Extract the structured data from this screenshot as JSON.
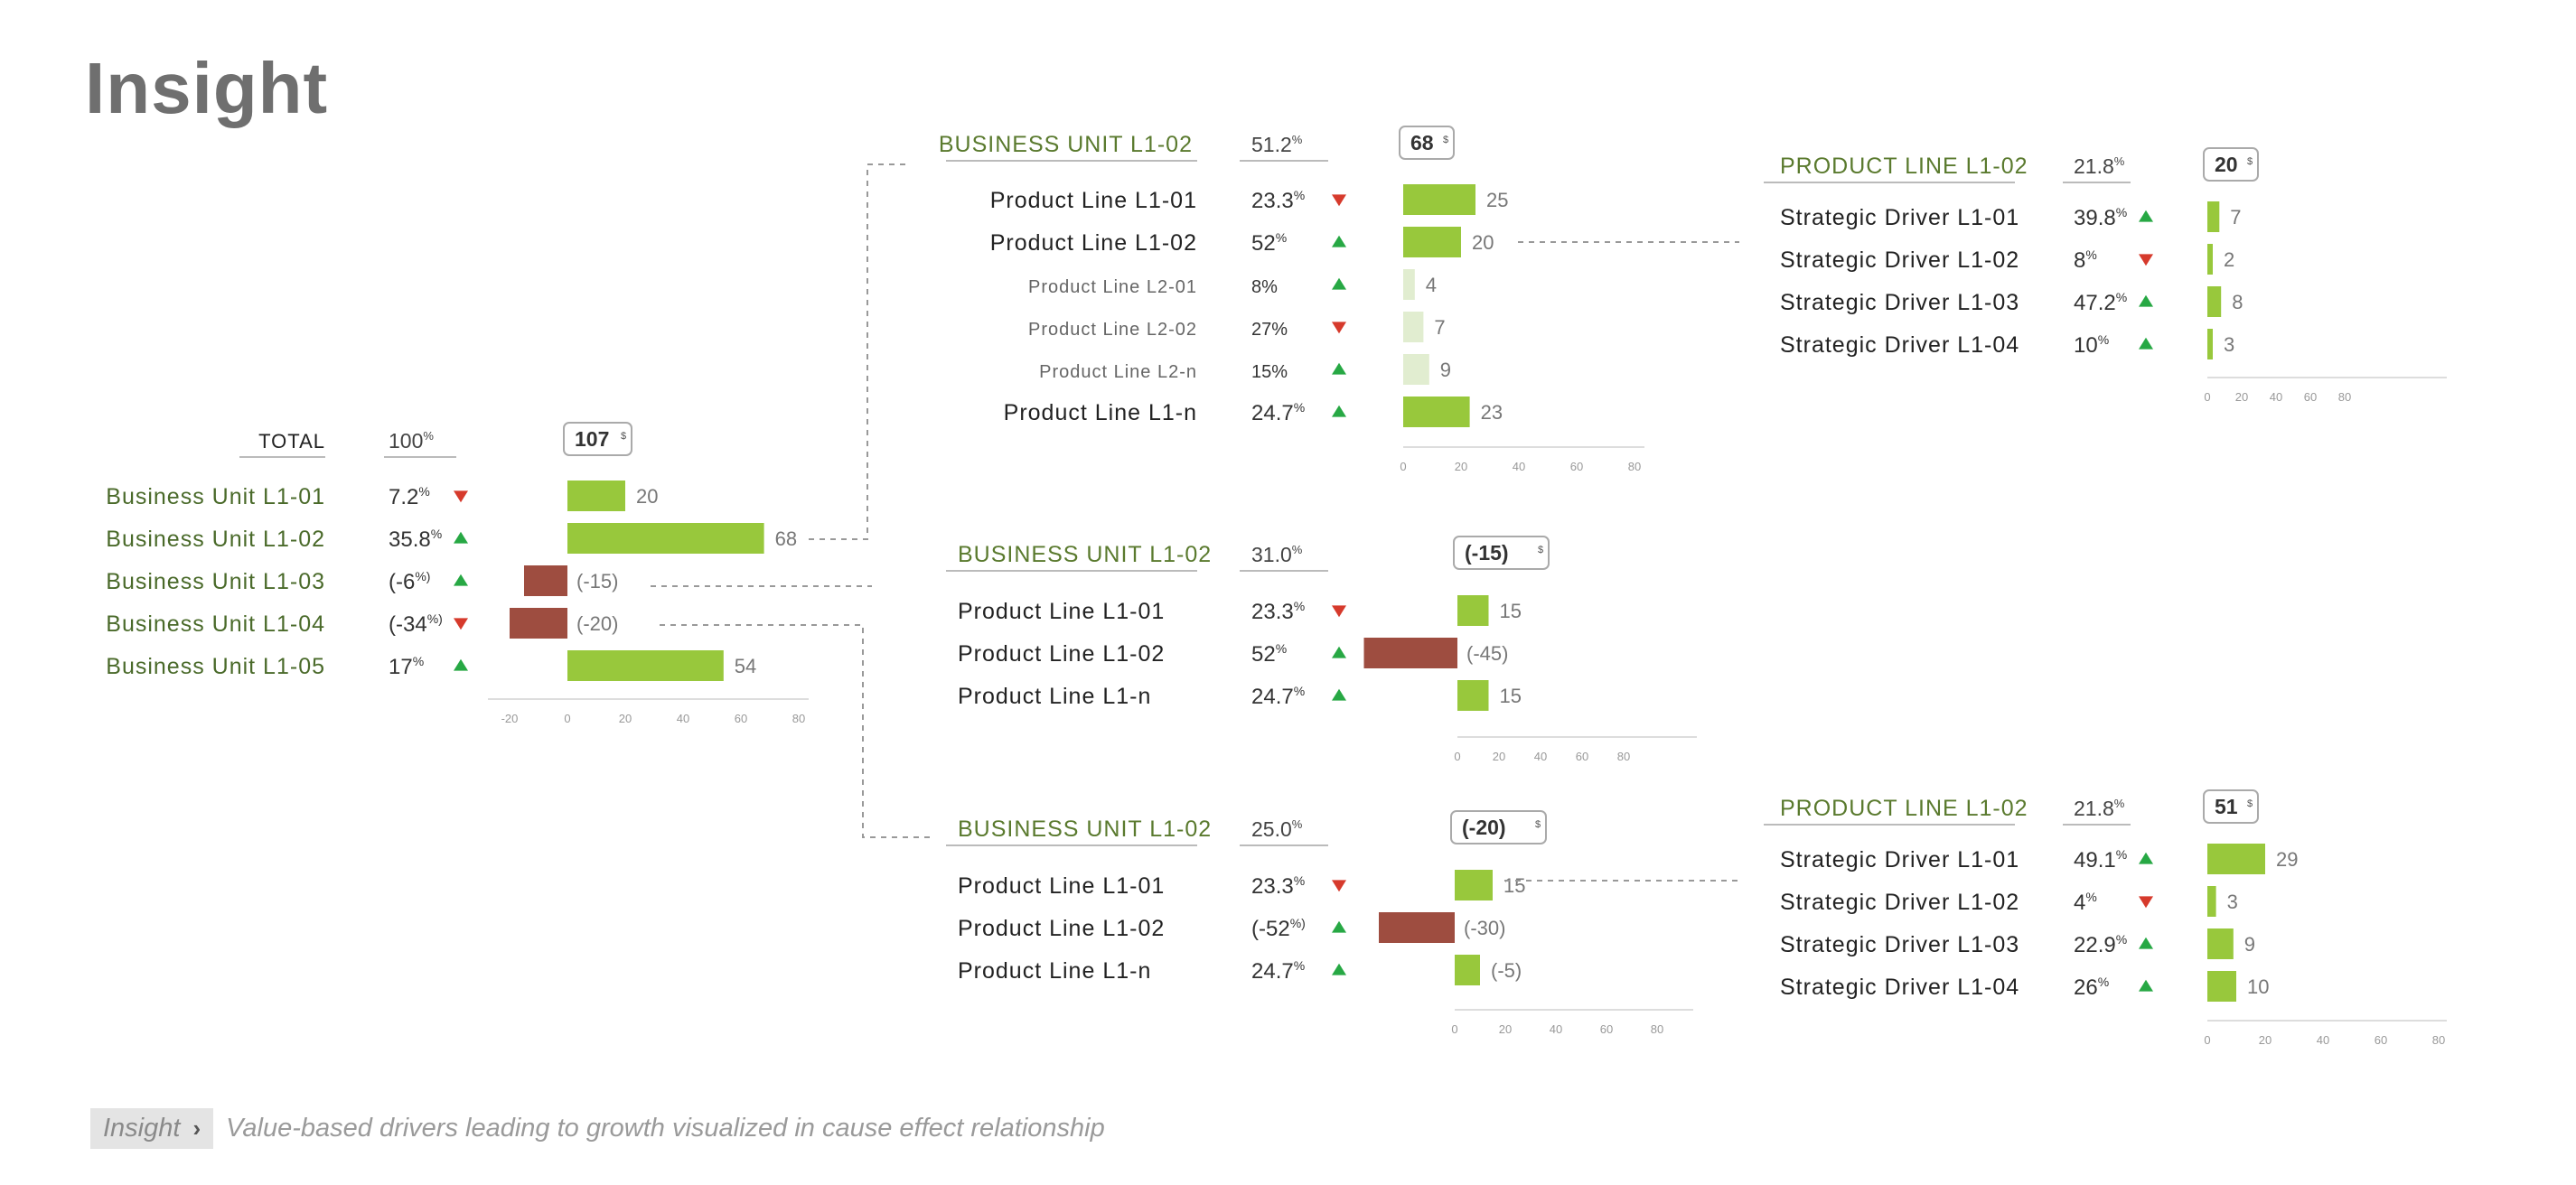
{
  "page": {
    "title": "Insight",
    "footer": {
      "tag": "Insight",
      "text": "Value-based drivers leading to growth visualized in cause effect relationship"
    }
  },
  "colors": {
    "positive": "#98c83c",
    "negative": "#9e4d40",
    "light": "#e1edd0",
    "header": "#5a7a2e",
    "up": "#27a844",
    "down": "#d63a2c",
    "axis": "#dddddd"
  },
  "chart_data": [
    {
      "type": "bar",
      "orientation": "horizontal",
      "id": "total",
      "header": {
        "label": "TOTAL",
        "pct": "100",
        "pct_unit": "%",
        "total": "107"
      },
      "xticks": [
        -20,
        0,
        20,
        40,
        60,
        80
      ],
      "xlim": [
        -25,
        80
      ],
      "rows": [
        {
          "label": "Business Unit L1-01",
          "pct": "7.2",
          "pct_unit": "%",
          "trend": "down",
          "value": 20,
          "value_label": "20"
        },
        {
          "label": "Business Unit L1-02",
          "pct": "35.8",
          "pct_unit": "%",
          "trend": "up",
          "value": 68,
          "value_label": "68"
        },
        {
          "label": "Business Unit L1-03",
          "pct": "(-6",
          "pct_unit": "%)",
          "trend": "up",
          "value": -15,
          "value_label": "(-15)"
        },
        {
          "label": "Business Unit L1-04",
          "pct": "(-34",
          "pct_unit": "%)",
          "trend": "down",
          "value": -20,
          "value_label": "(-20)"
        },
        {
          "label": "Business Unit L1-05",
          "pct": "17",
          "pct_unit": "%",
          "trend": "up",
          "value": 54,
          "value_label": "54"
        }
      ]
    },
    {
      "type": "bar",
      "orientation": "horizontal",
      "id": "bu-a",
      "header": {
        "label": "BUSINESS UNIT L1-02",
        "pct": "51.2",
        "pct_unit": "%",
        "total": "68"
      },
      "xticks": [
        0,
        20,
        40,
        60,
        80
      ],
      "xlim": [
        0,
        80
      ],
      "rows": [
        {
          "label": "Product Line L1-01",
          "pct": "23.3",
          "pct_unit": "%",
          "trend": "down",
          "value": 25,
          "value_label": "25"
        },
        {
          "label": "Product Line L1-02",
          "pct": "52",
          "pct_unit": "%",
          "trend": "up",
          "value": 20,
          "value_label": "20"
        },
        {
          "label": "Product Line L2-01",
          "pct": "8%",
          "pct_unit": "",
          "trend": "up",
          "value": 4,
          "value_label": "4",
          "sub": true
        },
        {
          "label": "Product Line L2-02",
          "pct": "27%",
          "pct_unit": "",
          "trend": "down",
          "value": 7,
          "value_label": "7",
          "sub": true
        },
        {
          "label": "Product Line L2-n",
          "pct": "15%",
          "pct_unit": "",
          "trend": "up",
          "value": 9,
          "value_label": "9",
          "sub": true
        },
        {
          "label": "Product Line L1-n",
          "pct": "24.7",
          "pct_unit": "%",
          "trend": "up",
          "value": 23,
          "value_label": "23"
        }
      ]
    },
    {
      "type": "bar",
      "orientation": "horizontal",
      "id": "bu-b",
      "header": {
        "label": "BUSINESS UNIT L1-02",
        "pct": "31.0",
        "pct_unit": "%",
        "total": "(-15)"
      },
      "xticks": [
        0,
        20,
        40,
        60,
        80
      ],
      "xlim": [
        -33,
        80
      ],
      "rows": [
        {
          "label": "Product Line L1-01",
          "pct": "23.3",
          "pct_unit": "%",
          "trend": "down",
          "value": 15,
          "value_label": "15"
        },
        {
          "label": "Product Line L1-02",
          "pct": "52",
          "pct_unit": "%",
          "trend": "up",
          "value": -45,
          "value_label": "(-45)"
        },
        {
          "label": "Product Line L1-n",
          "pct": "24.7",
          "pct_unit": "%",
          "trend": "up",
          "value": 15,
          "value_label": "15"
        }
      ]
    },
    {
      "type": "bar",
      "orientation": "horizontal",
      "id": "bu-c",
      "header": {
        "label": "BUSINESS UNIT L1-02",
        "pct": "25.0",
        "pct_unit": "%",
        "total": "(-20)"
      },
      "xticks": [
        0,
        20,
        40,
        60,
        80
      ],
      "xlim": [
        -25,
        80
      ],
      "rows": [
        {
          "label": "Product Line L1-01",
          "pct": "23.3",
          "pct_unit": "%",
          "trend": "down",
          "value": 15,
          "value_label": "15"
        },
        {
          "label": "Product Line L1-02",
          "pct": "(-52",
          "pct_unit": "%)",
          "trend": "up",
          "value": -30,
          "value_label": "(-30)"
        },
        {
          "label": "Product Line L1-n",
          "pct": "24.7",
          "pct_unit": "%",
          "trend": "up",
          "value": 10,
          "value_label": "(-5)"
        }
      ]
    },
    {
      "type": "bar",
      "orientation": "horizontal",
      "id": "pl-a",
      "header": {
        "label": "PRODUCT LINE L1-02",
        "pct": "21.8",
        "pct_unit": "%",
        "total": "20"
      },
      "xticks": [
        0,
        20,
        40,
        60,
        80
      ],
      "xlim": [
        0,
        80
      ],
      "rows": [
        {
          "label": "Strategic Driver L1-01",
          "pct": "39.8",
          "pct_unit": "%",
          "trend": "up",
          "value": 7,
          "value_label": "7"
        },
        {
          "label": "Strategic Driver L1-02",
          "pct": "8",
          "pct_unit": "%",
          "trend": "down",
          "value": 2,
          "value_label": "2"
        },
        {
          "label": "Strategic Driver L1-03",
          "pct": "47.2",
          "pct_unit": "%",
          "trend": "up",
          "value": 8,
          "value_label": "8"
        },
        {
          "label": "Strategic Driver L1-04",
          "pct": "10",
          "pct_unit": "%",
          "trend": "up",
          "value": 3,
          "value_label": "3"
        }
      ]
    },
    {
      "type": "bar",
      "orientation": "horizontal",
      "id": "pl-b",
      "header": {
        "label": "PRODUCT LINE L1-02",
        "pct": "21.8",
        "pct_unit": "%",
        "total": "51"
      },
      "xticks": [
        0,
        20,
        40,
        60,
        80
      ],
      "xlim": [
        0,
        80
      ],
      "rows": [
        {
          "label": "Strategic Driver L1-01",
          "pct": "49.1",
          "pct_unit": "%",
          "trend": "up",
          "value": 20,
          "value_label": "29"
        },
        {
          "label": "Strategic Driver L1-02",
          "pct": "4",
          "pct_unit": "%",
          "trend": "down",
          "value": 3,
          "value_label": "3"
        },
        {
          "label": "Strategic Driver L1-03",
          "pct": "22.9",
          "pct_unit": "%",
          "trend": "up",
          "value": 9,
          "value_label": "9"
        },
        {
          "label": "Strategic Driver L1-04",
          "pct": "26",
          "pct_unit": "%",
          "trend": "up",
          "value": 10,
          "value_label": "10"
        }
      ]
    }
  ]
}
